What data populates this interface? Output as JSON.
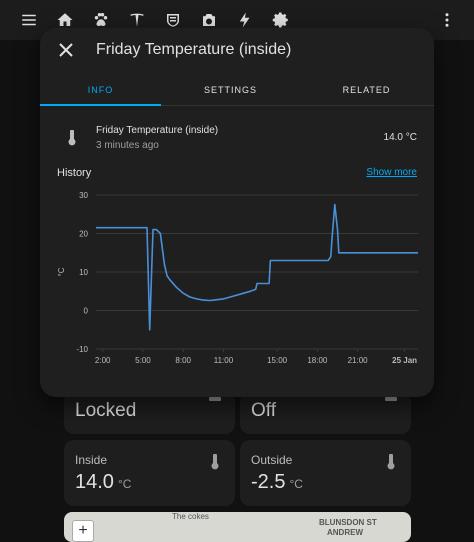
{
  "topbar": {
    "icons": [
      "menu-icon",
      "home-icon",
      "paw-icon",
      "tesla-icon",
      "badge-icon",
      "camera-icon",
      "lightning-icon",
      "gear-icon",
      "more-vert-icon"
    ]
  },
  "cards": {
    "lock_state": "Locked",
    "switch_state": "Off",
    "inside": {
      "label": "Inside",
      "value": "14.0",
      "unit": "°C"
    },
    "outside": {
      "label": "Outside",
      "value": "-2.5",
      "unit": "°C"
    }
  },
  "map": {
    "zoom_in": "+",
    "labels": [
      "The cokes",
      "BLUNSDON ST",
      "ANDREW"
    ]
  },
  "dialog": {
    "title": "Friday Temperature (inside)",
    "tabs": [
      "INFO",
      "SETTINGS",
      "RELATED"
    ],
    "entity_name": "Friday Temperature (inside)",
    "last_changed": "3 minutes ago",
    "state": "14.0 °C",
    "history_label": "History",
    "show_more": "Show more"
  },
  "chart_data": {
    "type": "line",
    "ylabel": "°C",
    "ylim": [
      -10,
      30
    ],
    "yticks": [
      "-10",
      "0",
      "10",
      "20",
      "30"
    ],
    "xticks": [
      "2:00",
      "5:00",
      "8:00",
      "11:00",
      "15:00",
      "18:00",
      "21:00",
      "25 Jan"
    ],
    "xlim": [
      1.5,
      25.5
    ],
    "colors": {
      "line": "#4a90d9",
      "grid": "#3a3a3a"
    },
    "series": [
      {
        "x": [
          1.5,
          5.3,
          5.5,
          5.75,
          6.0,
          6.3,
          6.6,
          6.8,
          7.0,
          7.5,
          8.0,
          8.5,
          9.0,
          9.5,
          10.0,
          10.5,
          11.0,
          11.5,
          12.0,
          12.5,
          13.0,
          13.4,
          13.5,
          14.4,
          14.5,
          16.5,
          18.8,
          19.0,
          19.1,
          19.3,
          19.5,
          19.6,
          25.5
        ],
        "y": [
          21.5,
          21.5,
          -5,
          21,
          21,
          20,
          12,
          9,
          8,
          6,
          4.5,
          3.5,
          3,
          2.7,
          2.6,
          2.8,
          3,
          3.5,
          4,
          4.5,
          5,
          5.5,
          7,
          7,
          13,
          13,
          13,
          14,
          19,
          27.5,
          21,
          15,
          15
        ]
      }
    ]
  }
}
